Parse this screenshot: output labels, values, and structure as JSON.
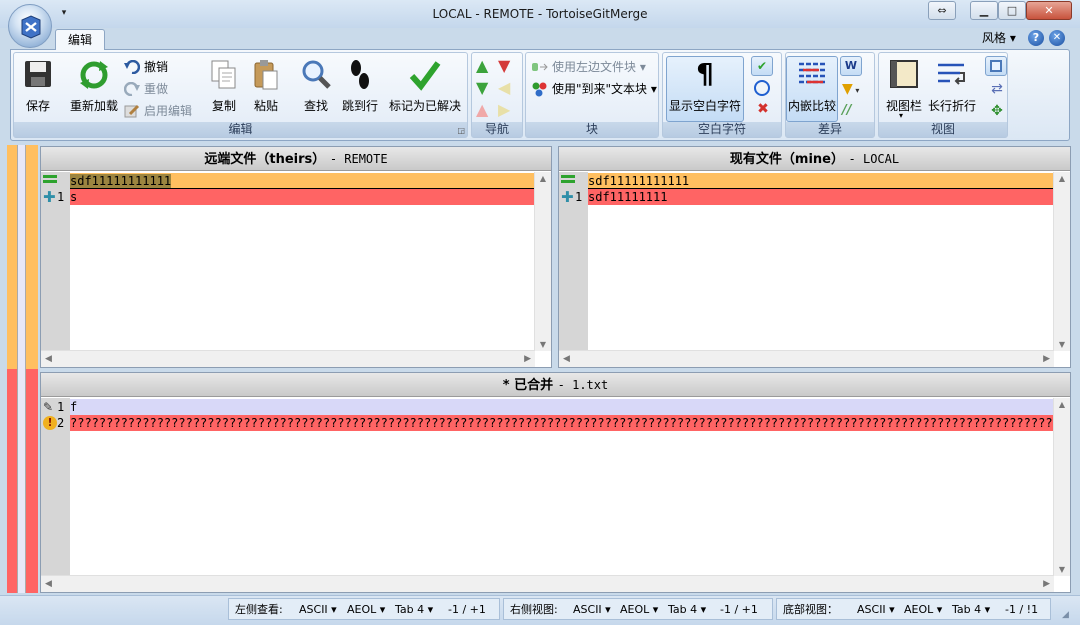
{
  "window": {
    "title": "LOCAL - REMOTE - TortoiseGitMerge"
  },
  "ribbon": {
    "tabs": [
      "编辑"
    ],
    "style_menu": "风格",
    "groups": {
      "edit": {
        "label": "编辑",
        "save": "保存",
        "reload": "重新加载",
        "undo": "撤销",
        "redo": "重做",
        "enable_edit": "启用编辑",
        "copy": "复制",
        "paste": "粘贴",
        "find": "查找",
        "goto_line": "跳到行",
        "mark_resolved": "标记为已解决"
      },
      "navigate": {
        "label": "导航"
      },
      "block": {
        "label": "块",
        "use_left_block": "使用左边文件块",
        "use_theirs_block": "使用\"到来\"文本块"
      },
      "whitespace": {
        "label": "空白字符",
        "show_whitespace": "显示空白字符"
      },
      "diff": {
        "label": "差异",
        "inline_diff": "内嵌比较"
      },
      "view": {
        "label": "视图",
        "viewbar": "视图栏",
        "wrap_long_lines": "长行折行"
      }
    }
  },
  "panes": {
    "left": {
      "title": "远端文件（theirs）",
      "tag": "- REMOTE",
      "lines": [
        {
          "num": "",
          "text": "sdf11111111111",
          "state": "normal"
        },
        {
          "num": "1",
          "text": "s",
          "state": "conflict"
        }
      ]
    },
    "right": {
      "title": "现有文件（mine）",
      "tag": "- LOCAL",
      "lines": [
        {
          "num": "",
          "text": "sdf11111111111",
          "state": "normal"
        },
        {
          "num": "1",
          "text": "sdf11111111",
          "state": "conflict"
        }
      ]
    },
    "bottom": {
      "title": "* 已合并",
      "tag": "- 1.txt",
      "lines": [
        {
          "num": "1",
          "text": "f",
          "state": "edited"
        },
        {
          "num": "2",
          "text": "????????????????????????????????????????????????????????????????????????????????????????????????????????????????????????????????????????????",
          "state": "conflict"
        }
      ]
    }
  },
  "statusbar": {
    "left": {
      "label": "左侧查看:",
      "encoding": "ASCII",
      "eol": "AEOL",
      "tab": "Tab 4",
      "pos": "-1 / +1"
    },
    "right": {
      "label": "右侧视图:",
      "encoding": "ASCII",
      "eol": "AEOL",
      "tab": "Tab 4",
      "pos": "-1 / +1"
    },
    "bottom": {
      "label": "底部视图：",
      "encoding": "ASCII",
      "eol": "AEOL",
      "tab": "Tab 4",
      "pos": "-1 / !1"
    }
  },
  "colors": {
    "conflict": "#ff6464",
    "normal_line": "#ffbf60",
    "edited": "#d8d8f8",
    "accent": "#c9daea"
  }
}
